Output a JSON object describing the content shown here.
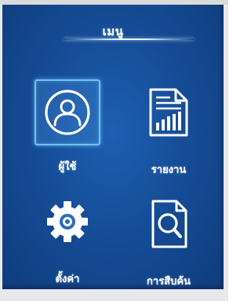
{
  "header": {
    "title": "เมนู"
  },
  "menu": {
    "items": [
      {
        "label": "ผู้ใช้",
        "icon": "user-icon",
        "selected": true
      },
      {
        "label": "รายงาน",
        "icon": "report-icon",
        "selected": false
      },
      {
        "label": "ตั้งค่า",
        "icon": "gear-icon",
        "selected": false
      },
      {
        "label": "การสืบค้น",
        "icon": "search-document-icon",
        "selected": false
      }
    ]
  },
  "colors": {
    "background": "#164d98",
    "selection_border": "#6fc3f2",
    "foreground": "#ffffff"
  }
}
